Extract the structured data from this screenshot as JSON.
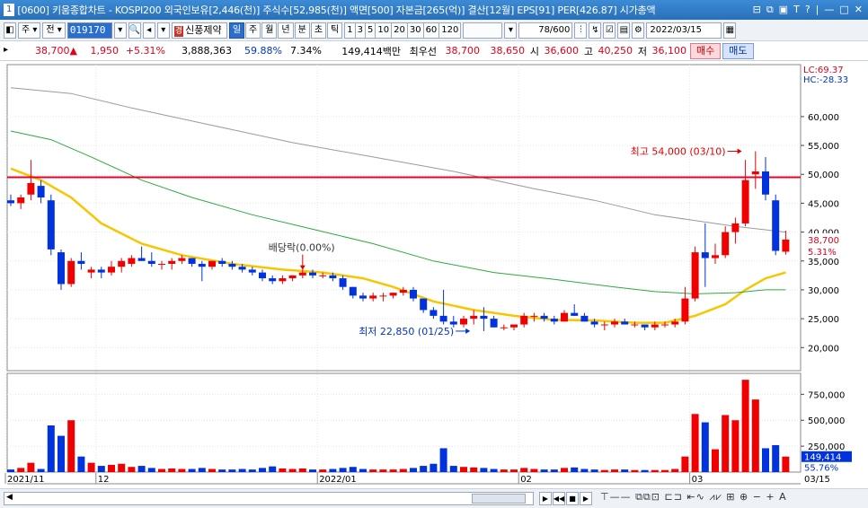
{
  "title": {
    "num": "1",
    "text": "[0600] 키움종합차트 - KOSPI200 외국인보유[2,446(천)] 주식수[52,985(천)] 액면[500] 자본금[265(억)] 결산[12월] EPS[91] PER[426.87] 시가총액",
    "buttons": [
      "⊟",
      "⧉",
      "▣",
      "T",
      "?",
      "|",
      "—",
      "□",
      "✕"
    ]
  },
  "toolbar": {
    "market": "주",
    "prev": "전",
    "code": "019170",
    "badge": "경",
    "stock_name": "신풍제약",
    "periods": [
      "일",
      "주",
      "월",
      "년",
      "분",
      "초",
      "틱"
    ],
    "active_period": "일",
    "minutes": [
      "1",
      "3",
      "5",
      "10",
      "20",
      "30",
      "60",
      "120"
    ],
    "count": "78/600",
    "date": "2022/03/15"
  },
  "info": {
    "price": "38,700",
    "arrow": "▲",
    "change": "1,950",
    "rate": "+5.31%",
    "volume": "3,888,363",
    "ratio1": "59.88%",
    "ratio2": "7.34%",
    "amount": "149,414백만",
    "best_label": "최우선",
    "best_sell": "38,700",
    "best_buy": "38,650",
    "open_label": "시",
    "open": "36,600",
    "high_label": "고",
    "high": "40,250",
    "low_label": "저",
    "low": "36,100",
    "buy_btn": "매수",
    "sell_btn": "매도"
  },
  "chart_data": {
    "type": "candlestick",
    "price_axis": [
      "60,000",
      "55,000",
      "50,000",
      "45,000",
      "40,000",
      "35,000",
      "30,000",
      "25,000",
      "20,000"
    ],
    "price_ticks": [
      60000,
      55000,
      50000,
      45000,
      40000,
      35000,
      30000,
      25000,
      20000
    ],
    "ylim": [
      16000,
      69000
    ],
    "volume_axis": [
      "750,000",
      "500,000",
      "250,000"
    ],
    "volume_ticks": [
      750000,
      500000,
      250000
    ],
    "volume_max": 900000,
    "lc_label": "LC:69.37",
    "hc_label": "HC:-28.33",
    "last_price_label": "38,700",
    "last_rate_label": "5.31%",
    "last_volume_label": "149,414",
    "last_volume_pct": "55.76%",
    "x_labels": [
      {
        "label": "2021/11",
        "index": 0
      },
      {
        "label": "12",
        "index": 9
      },
      {
        "label": "2022/01",
        "index": 31
      },
      {
        "label": "02",
        "index": 51
      },
      {
        "label": "03",
        "index": 68
      }
    ],
    "x_end_label": "03/15",
    "horizontal_line": 49500,
    "annotations": [
      {
        "text": "최고 54,000 (03/10)",
        "index": 73,
        "value": 54000,
        "side": "left"
      },
      {
        "text": "최저 22,850 (01/25)",
        "index": 46,
        "value": 22850,
        "side": "left"
      },
      {
        "text": "배당락(0.00%)",
        "index": 29,
        "value": 33000,
        "side": "top"
      }
    ],
    "candles": [
      {
        "o": 45500,
        "h": 46500,
        "l": 44500,
        "c": 45000,
        "v": 25000
      },
      {
        "o": 45000,
        "h": 46500,
        "l": 44000,
        "c": 46000,
        "v": 40000
      },
      {
        "o": 46500,
        "h": 52500,
        "l": 45500,
        "c": 48500,
        "v": 90000
      },
      {
        "o": 48000,
        "h": 49000,
        "l": 45000,
        "c": 46000,
        "v": 30000
      },
      {
        "o": 45500,
        "h": 46500,
        "l": 36000,
        "c": 37000,
        "v": 450000
      },
      {
        "o": 36500,
        "h": 37000,
        "l": 30000,
        "c": 31000,
        "v": 350000
      },
      {
        "o": 31000,
        "h": 35500,
        "l": 30500,
        "c": 35000,
        "v": 500000
      },
      {
        "o": 35000,
        "h": 36500,
        "l": 33500,
        "c": 34500,
        "v": 150000
      },
      {
        "o": 33000,
        "h": 34000,
        "l": 32000,
        "c": 33500,
        "v": 90000
      },
      {
        "o": 33500,
        "h": 34000,
        "l": 32000,
        "c": 33000,
        "v": 60000
      },
      {
        "o": 33000,
        "h": 35000,
        "l": 32500,
        "c": 34000,
        "v": 70000
      },
      {
        "o": 34000,
        "h": 35500,
        "l": 33000,
        "c": 35000,
        "v": 80000
      },
      {
        "o": 34500,
        "h": 36000,
        "l": 34000,
        "c": 35500,
        "v": 50000
      },
      {
        "o": 35500,
        "h": 37500,
        "l": 35000,
        "c": 35000,
        "v": 60000
      },
      {
        "o": 35000,
        "h": 36500,
        "l": 34000,
        "c": 34500,
        "v": 40000
      },
      {
        "o": 34500,
        "h": 35000,
        "l": 33500,
        "c": 34500,
        "v": 30000
      },
      {
        "o": 34500,
        "h": 35500,
        "l": 33500,
        "c": 35000,
        "v": 35000
      },
      {
        "o": 35000,
        "h": 36000,
        "l": 34500,
        "c": 35500,
        "v": 30000
      },
      {
        "o": 35500,
        "h": 35500,
        "l": 34000,
        "c": 34500,
        "v": 30000
      },
      {
        "o": 34500,
        "h": 35000,
        "l": 31500,
        "c": 34000,
        "v": 40000
      },
      {
        "o": 34000,
        "h": 35000,
        "l": 33500,
        "c": 35000,
        "v": 30000
      },
      {
        "o": 35000,
        "h": 35500,
        "l": 34000,
        "c": 34500,
        "v": 25000
      },
      {
        "o": 34500,
        "h": 35000,
        "l": 33500,
        "c": 34000,
        "v": 25000
      },
      {
        "o": 34000,
        "h": 34500,
        "l": 33000,
        "c": 33500,
        "v": 30000
      },
      {
        "o": 33500,
        "h": 34000,
        "l": 32500,
        "c": 33000,
        "v": 25000
      },
      {
        "o": 33000,
        "h": 33500,
        "l": 31500,
        "c": 32000,
        "v": 40000
      },
      {
        "o": 32000,
        "h": 32500,
        "l": 31000,
        "c": 31500,
        "v": 55000
      },
      {
        "o": 31500,
        "h": 32500,
        "l": 31000,
        "c": 32000,
        "v": 35000
      },
      {
        "o": 32000,
        "h": 32500,
        "l": 31500,
        "c": 32500,
        "v": 30000
      },
      {
        "o": 32500,
        "h": 33500,
        "l": 32000,
        "c": 33000,
        "v": 35000
      },
      {
        "o": 33000,
        "h": 33500,
        "l": 32000,
        "c": 32500,
        "v": 25000
      },
      {
        "o": 32500,
        "h": 33000,
        "l": 32000,
        "c": 32500,
        "v": 25000
      },
      {
        "o": 32500,
        "h": 33000,
        "l": 31500,
        "c": 32000,
        "v": 30000
      },
      {
        "o": 32000,
        "h": 32500,
        "l": 30000,
        "c": 30500,
        "v": 40000
      },
      {
        "o": 30500,
        "h": 30500,
        "l": 28500,
        "c": 29000,
        "v": 50000
      },
      {
        "o": 29000,
        "h": 29500,
        "l": 28000,
        "c": 28500,
        "v": 30000
      },
      {
        "o": 28500,
        "h": 29500,
        "l": 28000,
        "c": 29000,
        "v": 25000
      },
      {
        "o": 29000,
        "h": 29500,
        "l": 28000,
        "c": 29000,
        "v": 25000
      },
      {
        "o": 29000,
        "h": 29500,
        "l": 28500,
        "c": 29500,
        "v": 25000
      },
      {
        "o": 29500,
        "h": 30500,
        "l": 29000,
        "c": 30000,
        "v": 30000
      },
      {
        "o": 30000,
        "h": 30500,
        "l": 28000,
        "c": 28500,
        "v": 40000
      },
      {
        "o": 28500,
        "h": 28500,
        "l": 26000,
        "c": 26500,
        "v": 60000
      },
      {
        "o": 26500,
        "h": 27000,
        "l": 25000,
        "c": 25500,
        "v": 80000
      },
      {
        "o": 25500,
        "h": 30000,
        "l": 24000,
        "c": 24500,
        "v": 230000
      },
      {
        "o": 24500,
        "h": 25500,
        "l": 23500,
        "c": 24000,
        "v": 60000
      },
      {
        "o": 24000,
        "h": 25500,
        "l": 23500,
        "c": 25000,
        "v": 50000
      },
      {
        "o": 25000,
        "h": 26500,
        "l": 24000,
        "c": 25500,
        "v": 45000
      },
      {
        "o": 25500,
        "h": 27000,
        "l": 22850,
        "c": 25000,
        "v": 40000
      },
      {
        "o": 25000,
        "h": 25500,
        "l": 23500,
        "c": 23500,
        "v": 30000
      },
      {
        "o": 23500,
        "h": 24000,
        "l": 23000,
        "c": 23500,
        "v": 25000
      },
      {
        "o": 23500,
        "h": 24000,
        "l": 23000,
        "c": 24000,
        "v": 25000
      },
      {
        "o": 24000,
        "h": 26000,
        "l": 23500,
        "c": 25500,
        "v": 40000
      },
      {
        "o": 25500,
        "h": 26000,
        "l": 24500,
        "c": 25500,
        "v": 30000
      },
      {
        "o": 25500,
        "h": 26000,
        "l": 24500,
        "c": 25000,
        "v": 25000
      },
      {
        "o": 25000,
        "h": 25500,
        "l": 24000,
        "c": 24500,
        "v": 25000
      },
      {
        "o": 24500,
        "h": 26500,
        "l": 24500,
        "c": 26000,
        "v": 40000
      },
      {
        "o": 26000,
        "h": 27500,
        "l": 25500,
        "c": 25500,
        "v": 45000
      },
      {
        "o": 25500,
        "h": 26000,
        "l": 24500,
        "c": 24500,
        "v": 30000
      },
      {
        "o": 24500,
        "h": 25000,
        "l": 23500,
        "c": 24000,
        "v": 25000
      },
      {
        "o": 24000,
        "h": 24500,
        "l": 23000,
        "c": 24000,
        "v": 20000
      },
      {
        "o": 24000,
        "h": 25000,
        "l": 23500,
        "c": 24500,
        "v": 25000
      },
      {
        "o": 24500,
        "h": 25000,
        "l": 24000,
        "c": 24000,
        "v": 25000
      },
      {
        "o": 24000,
        "h": 24500,
        "l": 23500,
        "c": 24000,
        "v": 20000
      },
      {
        "o": 24000,
        "h": 24000,
        "l": 23000,
        "c": 23500,
        "v": 20000
      },
      {
        "o": 23500,
        "h": 24500,
        "l": 23000,
        "c": 24000,
        "v": 20000
      },
      {
        "o": 24000,
        "h": 24500,
        "l": 23500,
        "c": 24000,
        "v": 20000
      },
      {
        "o": 24000,
        "h": 25000,
        "l": 23500,
        "c": 24500,
        "v": 30000
      },
      {
        "o": 24500,
        "h": 30500,
        "l": 24000,
        "c": 28500,
        "v": 150000
      },
      {
        "o": 28500,
        "h": 37500,
        "l": 28000,
        "c": 36500,
        "v": 560000
      },
      {
        "o": 36500,
        "h": 41500,
        "l": 30500,
        "c": 35500,
        "v": 480000
      },
      {
        "o": 35500,
        "h": 38000,
        "l": 34500,
        "c": 36000,
        "v": 220000
      },
      {
        "o": 36000,
        "h": 41000,
        "l": 35500,
        "c": 40000,
        "v": 550000
      },
      {
        "o": 40000,
        "h": 42500,
        "l": 38000,
        "c": 41500,
        "v": 500000
      },
      {
        "o": 41500,
        "h": 52500,
        "l": 41000,
        "c": 49000,
        "v": 890000
      },
      {
        "o": 50000,
        "h": 54000,
        "l": 47500,
        "c": 50500,
        "v": 700000
      },
      {
        "o": 50500,
        "h": 53000,
        "l": 45500,
        "c": 46500,
        "v": 230000
      },
      {
        "o": 45500,
        "h": 46500,
        "l": 36000,
        "c": 36750,
        "v": 260000
      },
      {
        "o": 36600,
        "h": 40250,
        "l": 36100,
        "c": 38700,
        "v": 149414
      }
    ],
    "ma": [
      {
        "color": "#f7c600",
        "width": 2.5,
        "values": [
          [
            0,
            51000
          ],
          [
            3,
            49000
          ],
          [
            6,
            46000
          ],
          [
            9,
            41500
          ],
          [
            13,
            38000
          ],
          [
            17,
            36000
          ],
          [
            22,
            34500
          ],
          [
            27,
            33500
          ],
          [
            31,
            33000
          ],
          [
            35,
            32000
          ],
          [
            38,
            30500
          ],
          [
            42,
            28000
          ],
          [
            46,
            26500
          ],
          [
            50,
            25500
          ],
          [
            54,
            24800
          ],
          [
            58,
            24700
          ],
          [
            62,
            24300
          ],
          [
            65,
            24300
          ],
          [
            68,
            25500
          ],
          [
            71,
            27500
          ],
          [
            73,
            30000
          ],
          [
            75,
            32000
          ],
          [
            77,
            33000
          ]
        ]
      },
      {
        "color": "#2eaa3e",
        "width": 1,
        "values": [
          [
            0,
            57500
          ],
          [
            4,
            56000
          ],
          [
            8,
            53000
          ],
          [
            13,
            49000
          ],
          [
            18,
            46000
          ],
          [
            24,
            43000
          ],
          [
            30,
            40500
          ],
          [
            36,
            38000
          ],
          [
            42,
            35000
          ],
          [
            48,
            33000
          ],
          [
            54,
            31800
          ],
          [
            60,
            30500
          ],
          [
            64,
            29700
          ],
          [
            68,
            29300
          ],
          [
            72,
            29500
          ],
          [
            75,
            30000
          ],
          [
            77,
            30000
          ]
        ]
      },
      {
        "color": "#9a9a9a",
        "width": 1,
        "values": [
          [
            0,
            65000
          ],
          [
            6,
            64000
          ],
          [
            12,
            61500
          ],
          [
            20,
            58500
          ],
          [
            28,
            55500
          ],
          [
            36,
            53000
          ],
          [
            44,
            50500
          ],
          [
            52,
            47500
          ],
          [
            58,
            45500
          ],
          [
            64,
            43000
          ],
          [
            68,
            42000
          ],
          [
            72,
            41000
          ],
          [
            77,
            40000
          ]
        ]
      }
    ]
  }
}
